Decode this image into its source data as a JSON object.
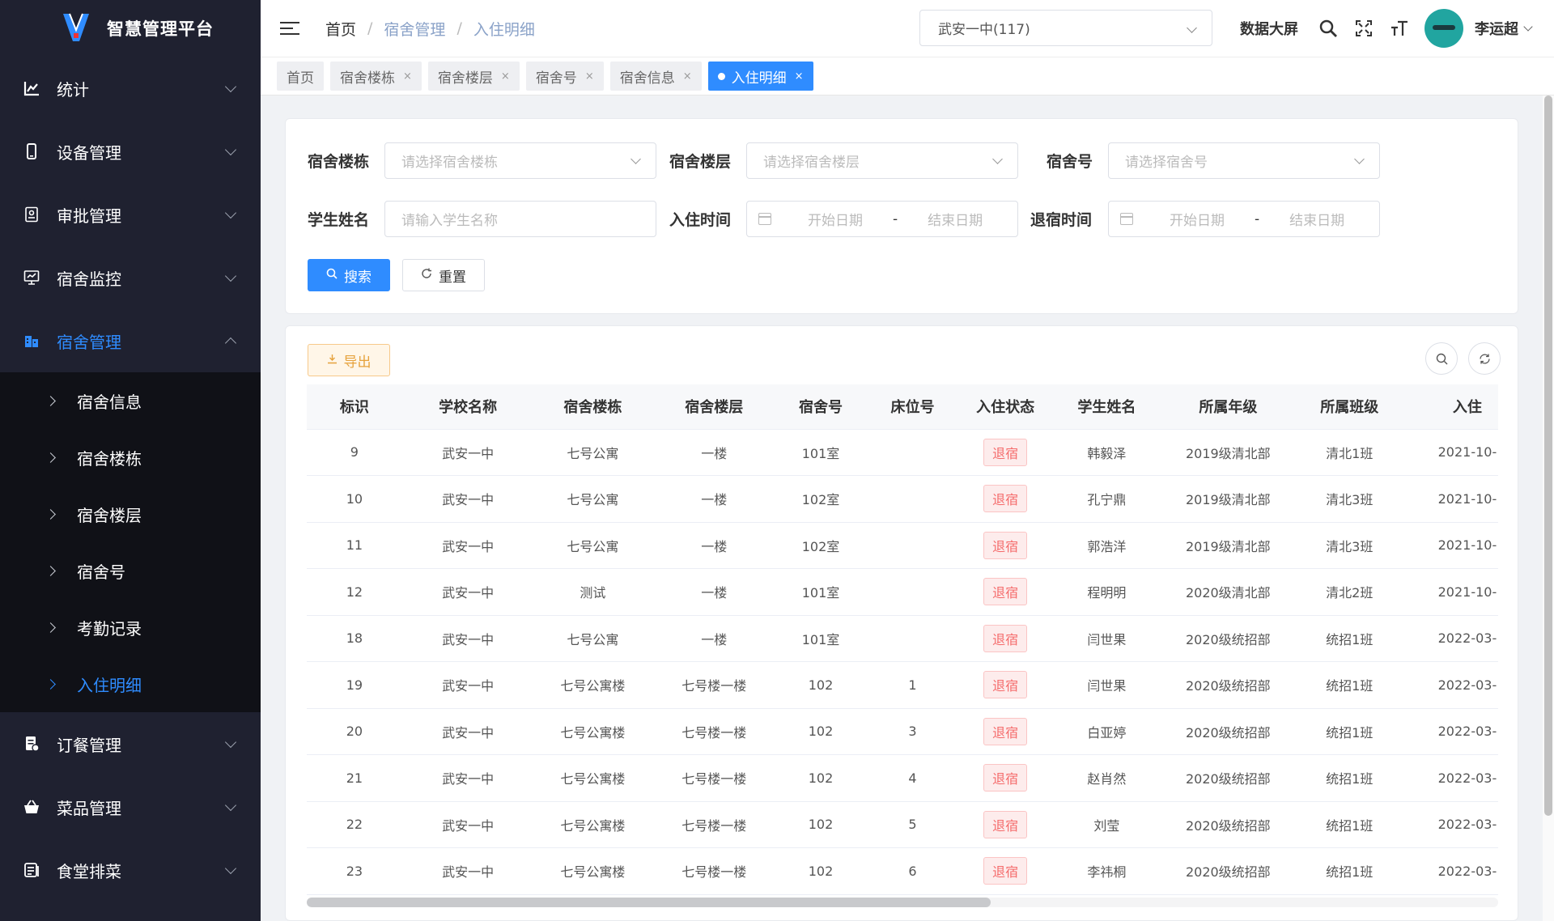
{
  "app": {
    "title": "智慧管理平台"
  },
  "sidebar": {
    "items_top": [
      {
        "label": "统计",
        "icon": "chart-line-icon"
      },
      {
        "label": "设备管理",
        "icon": "mobile-icon"
      },
      {
        "label": "审批管理",
        "icon": "approval-icon"
      },
      {
        "label": "宿舍监控",
        "icon": "monitor-icon"
      }
    ],
    "dorm": {
      "label": "宿舍管理",
      "icon": "building-icon"
    },
    "sub_items": [
      {
        "label": "宿舍信息"
      },
      {
        "label": "宿舍楼栋"
      },
      {
        "label": "宿舍楼层"
      },
      {
        "label": "宿舍号"
      },
      {
        "label": "考勤记录"
      },
      {
        "label": "入住明细"
      }
    ],
    "items_bottom": [
      {
        "label": "订餐管理",
        "icon": "order-icon"
      },
      {
        "label": "菜品管理",
        "icon": "basket-icon"
      },
      {
        "label": "食堂排菜",
        "icon": "menu-list-icon"
      }
    ]
  },
  "header": {
    "breadcrumb": [
      "首页",
      "宿舍管理",
      "入住明细"
    ],
    "school_select": "武安一中(117)",
    "data_screen": "数据大屏",
    "user_name": "李运超"
  },
  "tabs": [
    {
      "label": "首页",
      "closable": false
    },
    {
      "label": "宿舍楼栋",
      "closable": true
    },
    {
      "label": "宿舍楼层",
      "closable": true
    },
    {
      "label": "宿舍号",
      "closable": true
    },
    {
      "label": "宿舍信息",
      "closable": true
    },
    {
      "label": "入住明细",
      "closable": true,
      "active": true
    }
  ],
  "tab_close": "×",
  "search": {
    "building_label": "宿舍楼栋",
    "building_placeholder": "请选择宿舍楼栋",
    "floor_label": "宿舍楼层",
    "floor_placeholder": "请选择宿舍楼层",
    "room_label": "宿舍号",
    "room_placeholder": "请选择宿舍号",
    "student_label": "学生姓名",
    "student_placeholder": "请输入学生名称",
    "checkin_label": "入住时间",
    "checkout_label": "退宿时间",
    "start_date": "开始日期",
    "end_date": "结束日期",
    "range_sep": "-",
    "search_btn": "搜索",
    "reset_btn": "重置"
  },
  "toolbar": {
    "export_btn": "导出"
  },
  "table": {
    "columns": [
      "标识",
      "学校名称",
      "宿舍楼栋",
      "宿舍楼层",
      "宿舍号",
      "床位号",
      "入住状态",
      "学生姓名",
      "所属年级",
      "所属班级",
      "入住"
    ],
    "rows": [
      [
        "9",
        "武安一中",
        "七号公寓",
        "一楼",
        "101室",
        "",
        "退宿",
        "韩毅泽",
        "2019级清北部",
        "清北1班",
        "2021-10-"
      ],
      [
        "10",
        "武安一中",
        "七号公寓",
        "一楼",
        "102室",
        "",
        "退宿",
        "孔宁鼎",
        "2019级清北部",
        "清北3班",
        "2021-10-"
      ],
      [
        "11",
        "武安一中",
        "七号公寓",
        "一楼",
        "102室",
        "",
        "退宿",
        "郭浩洋",
        "2019级清北部",
        "清北3班",
        "2021-10-"
      ],
      [
        "12",
        "武安一中",
        "测试",
        "一楼",
        "101室",
        "",
        "退宿",
        "程明明",
        "2020级清北部",
        "清北2班",
        "2021-10-"
      ],
      [
        "18",
        "武安一中",
        "七号公寓",
        "一楼",
        "101室",
        "",
        "退宿",
        "闫世果",
        "2020级统招部",
        "统招1班",
        "2022-03-"
      ],
      [
        "19",
        "武安一中",
        "七号公寓楼",
        "七号楼一楼",
        "102",
        "1",
        "退宿",
        "闫世果",
        "2020级统招部",
        "统招1班",
        "2022-03-"
      ],
      [
        "20",
        "武安一中",
        "七号公寓楼",
        "七号楼一楼",
        "102",
        "3",
        "退宿",
        "白亚婷",
        "2020级统招部",
        "统招1班",
        "2022-03-"
      ],
      [
        "21",
        "武安一中",
        "七号公寓楼",
        "七号楼一楼",
        "102",
        "4",
        "退宿",
        "赵肖然",
        "2020级统招部",
        "统招1班",
        "2022-03-"
      ],
      [
        "22",
        "武安一中",
        "七号公寓楼",
        "七号楼一楼",
        "102",
        "5",
        "退宿",
        "刘莹",
        "2020级统招部",
        "统招1班",
        "2022-03-"
      ],
      [
        "23",
        "武安一中",
        "七号公寓楼",
        "七号楼一楼",
        "102",
        "6",
        "退宿",
        "李祎桐",
        "2020级统招部",
        "统招1班",
        "2022-03-"
      ]
    ]
  },
  "colors": {
    "sidebar_bg": "#1f2130",
    "submenu_bg": "#101117",
    "accent": "#2f8cff",
    "danger": "#f56c6c",
    "warning": "#e6a23c"
  }
}
